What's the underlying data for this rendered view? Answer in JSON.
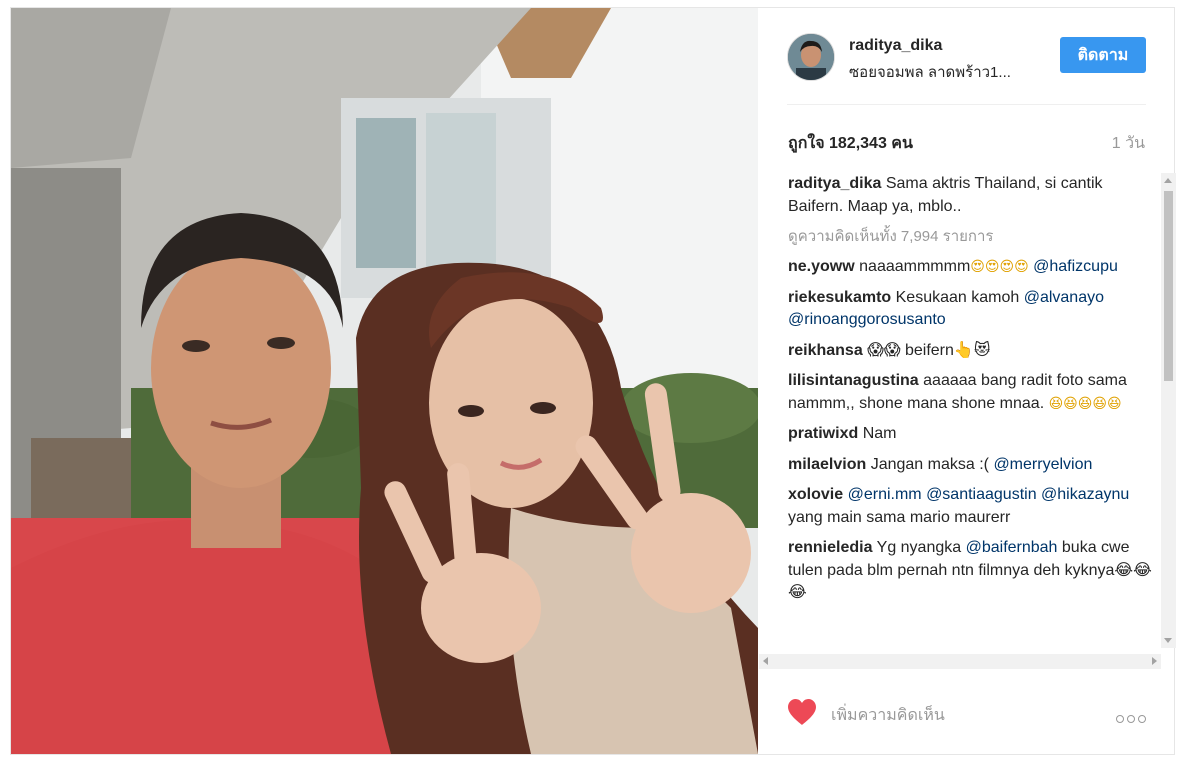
{
  "post": {
    "username": "raditya_dika",
    "location": "ซอยจอมพล ลาดพร้าว1...",
    "follow_label": "ติดตาม",
    "likes": "ถูกใจ 182,343 คน",
    "time": "1 วัน"
  },
  "caption": {
    "user": "raditya_dika",
    "text": "Sama aktris Thailand, si cantik Baifern. Maap ya, mblo.."
  },
  "view_all_comments": "ดูความคิดเห็นทั้ง 7,994 รายการ",
  "comments": [
    {
      "user": "ne.yoww",
      "text": "naaaammmmm",
      "emoji": "😍😍😍😍",
      "mention": "@hafizcupu",
      "after": ""
    },
    {
      "user": "riekesukamto",
      "text": "Kesukaan kamoh ",
      "emoji": "",
      "mention": "@alvanayo @rinoanggorosusanto",
      "after": ""
    },
    {
      "user": "reikhansa",
      "text": "😱😱 beifern👆😻",
      "emoji": "",
      "mention": "",
      "after": ""
    },
    {
      "user": "lilisintanagustina",
      "text": "aaaaaa bang radit foto sama nammm,, shone mana shone mnaa. ",
      "emoji": "😆😆😆😆😆",
      "mention": "",
      "after": ""
    },
    {
      "user": "pratiwixd",
      "text": "Nam",
      "emoji": "",
      "mention": "",
      "after": ""
    },
    {
      "user": "milaelvion",
      "text": "Jangan maksa :( ",
      "emoji": "",
      "mention": "@merryelvion",
      "after": ""
    },
    {
      "user": "xolovie",
      "text": "",
      "emoji": "",
      "mention": "@erni.mm @santiaagustin @hikazaynu",
      "after": " yang main sama mario maurerr"
    },
    {
      "user": "rennieledia",
      "text": "Yg nyangka ",
      "emoji": "",
      "mention": "@baifernbah",
      "after": " buka cwe tulen pada blm pernah ntn filmnya deh kyknya😂😂😂"
    }
  ],
  "footer": {
    "add_comment_placeholder": "เพิ่มความคิดเห็น",
    "heart_color": "#ed4956"
  },
  "icons": {
    "heart": "heart-icon",
    "more": "more-options-icon"
  }
}
